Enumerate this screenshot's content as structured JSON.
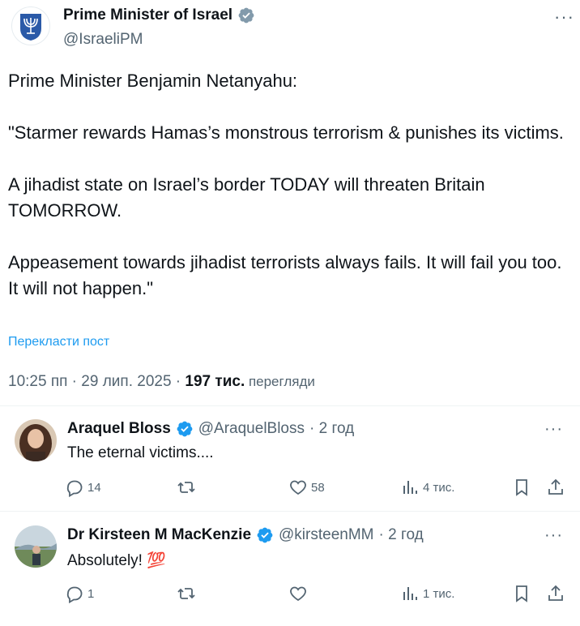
{
  "tweet": {
    "author_name": "Prime Minister of Israel",
    "author_handle": "@IsraeliPM",
    "more_icon": "more-icon",
    "paragraphs": [
      "Prime Minister Benjamin Netanyahu:",
      "\"Starmer rewards Hamas’s monstrous terrorism & punishes its victims.",
      "A jihadist state on Israel’s border TODAY will threaten Britain TOMORROW.",
      "Appeasement towards jihadist terrorists always fails. It will fail you too. It will not happen.\""
    ],
    "translate_label": "Перекласти пост",
    "timestamp": "10:25 пп · 29 лип. 2025 · ",
    "views_count": "197 тис.",
    "views_label": " перегляди"
  },
  "replies": [
    {
      "name": "Araquel Bloss",
      "handle": "@AraquelBloss",
      "time": "· 2 год",
      "text": "The eternal victims....",
      "replies_count": "14",
      "reposts_count": "",
      "likes_count": "58",
      "views_count": "4 тис."
    },
    {
      "name": "Dr Kirsteen M MacKenzie",
      "handle": "@kirsteenMM",
      "time": "· 2 год",
      "text": "Absolutely! 💯",
      "replies_count": "1",
      "reposts_count": "",
      "likes_count": "",
      "views_count": "1 тис."
    }
  ],
  "colors": {
    "accent": "#1d9bf0",
    "text_primary": "#0f1419",
    "text_secondary": "#536471",
    "divider": "#eff3f4"
  }
}
